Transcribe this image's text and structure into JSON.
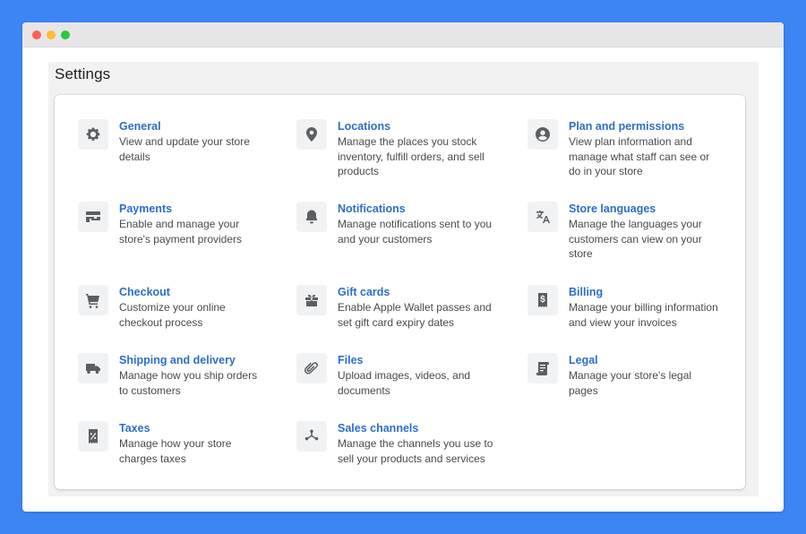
{
  "window": {
    "traffic_lights": [
      "close",
      "minimize",
      "zoom"
    ]
  },
  "page": {
    "title": "Settings"
  },
  "colors": {
    "background": "#3d84f5",
    "link": "#2c6ecb",
    "icon": "#5c5f62"
  },
  "settings": [
    {
      "id": "general",
      "icon": "gear-icon",
      "title": "General",
      "description": "View and update your store details"
    },
    {
      "id": "locations",
      "icon": "location-pin-icon",
      "title": "Locations",
      "description": "Manage the places you stock inventory, fulfill orders, and sell products"
    },
    {
      "id": "plan",
      "icon": "user-circle-icon",
      "title": "Plan and permissions",
      "description": "View plan information and manage what staff can see or do in your store"
    },
    {
      "id": "payments",
      "icon": "payment-card-icon",
      "title": "Payments",
      "description": "Enable and manage your store's payment providers"
    },
    {
      "id": "notifications",
      "icon": "bell-icon",
      "title": "Notifications",
      "description": "Manage notifications sent to you and your customers"
    },
    {
      "id": "languages",
      "icon": "translate-icon",
      "title": "Store languages",
      "description": "Manage the languages your customers can view on your store"
    },
    {
      "id": "checkout",
      "icon": "cart-icon",
      "title": "Checkout",
      "description": "Customize your online checkout process"
    },
    {
      "id": "gift_cards",
      "icon": "gift-icon",
      "title": "Gift cards",
      "description": "Enable Apple Wallet passes and set gift card expiry dates"
    },
    {
      "id": "billing",
      "icon": "receipt-dollar-icon",
      "title": "Billing",
      "description": "Manage your billing information and view your invoices"
    },
    {
      "id": "shipping",
      "icon": "truck-icon",
      "title": "Shipping and delivery",
      "description": "Manage how you ship orders to customers"
    },
    {
      "id": "files",
      "icon": "paperclip-icon",
      "title": "Files",
      "description": "Upload images, videos, and documents"
    },
    {
      "id": "legal",
      "icon": "scroll-icon",
      "title": "Legal",
      "description": "Manage your store's legal pages"
    },
    {
      "id": "taxes",
      "icon": "tax-receipt-icon",
      "title": "Taxes",
      "description": "Manage how your store charges taxes"
    },
    {
      "id": "sales_channels",
      "icon": "channels-icon",
      "title": "Sales channels",
      "description": "Manage the channels you use to sell your products and services"
    }
  ]
}
